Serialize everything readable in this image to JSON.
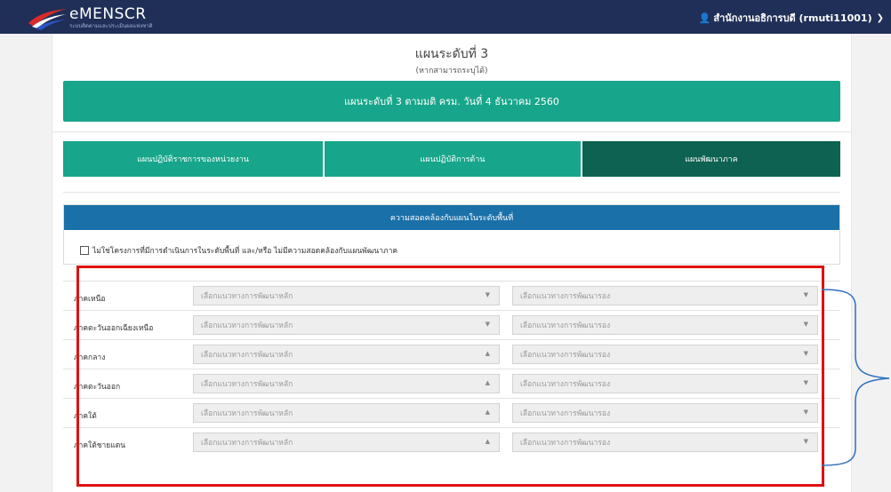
{
  "header": {
    "brand_name": "eMENSCR",
    "brand_sub": "ระบบติดตามและประเมินผลแห่งชาติ",
    "user_label": "สำนักงานอธิการบดี (rmuti11001)"
  },
  "plan": {
    "title": "แผนระดับที่ 3",
    "subtitle": "(หากสามารถระบุได้)",
    "banner": "แผนระดับที่ 3 ตามมติ ครม. วันที่ 4 ธันวาคม 2560"
  },
  "tabs": [
    {
      "label": "แผนปฏิบัติราชการของหน่วยงาน"
    },
    {
      "label": "แผนปฏิบัติการด้าน"
    },
    {
      "label": "แผนพัฒนาภาค"
    }
  ],
  "consistency": {
    "header": "ความสอดคล้องกับแผนในระดับพื้นที่",
    "checkbox_label": "ไม่ใช่โครงการที่มีการดำเนินการในระดับพื้นที่ และ/หรือ ไม่มีความสอดคล้องกับแผนพัฒนาภาค"
  },
  "regions": [
    {
      "name": "ภาคเหนือ",
      "primary": "เลือกแนวทางการพัฒนาหลัก",
      "secondary": "เลือกแนวทางการพัฒนารอง",
      "primary_caret": "▼"
    },
    {
      "name": "ภาคตะวันออกเฉียงเหนือ",
      "primary": "เลือกแนวทางการพัฒนาหลัก",
      "secondary": "เลือกแนวทางการพัฒนารอง",
      "primary_caret": "▼"
    },
    {
      "name": "ภาคกลาง",
      "primary": "เลือกแนวทางการพัฒนาหลัก",
      "secondary": "เลือกแนวทางการพัฒนารอง",
      "primary_caret": "▲"
    },
    {
      "name": "ภาคตะวันออก",
      "primary": "เลือกแนวทางการพัฒนาหลัก",
      "secondary": "เลือกแนวทางการพัฒนารอง",
      "primary_caret": "▲"
    },
    {
      "name": "ภาคใต้",
      "primary": "เลือกแนวทางการพัฒนาหลัก",
      "secondary": "เลือกแนวทางการพัฒนารอง",
      "primary_caret": "▲"
    },
    {
      "name": "ภาคใต้ชายแดน",
      "primary": "เลือกแนวทางการพัฒนาหลัก",
      "secondary": "เลือกแนวทางการพัฒนารอง",
      "primary_caret": "▲"
    }
  ],
  "colors": {
    "navbar": "#1f2f57",
    "green": "#17a68b",
    "dark_green": "#0d6251",
    "blue_header": "#1a70a8",
    "highlight_red": "#e01010",
    "bracket_blue": "#2e6fc0"
  }
}
